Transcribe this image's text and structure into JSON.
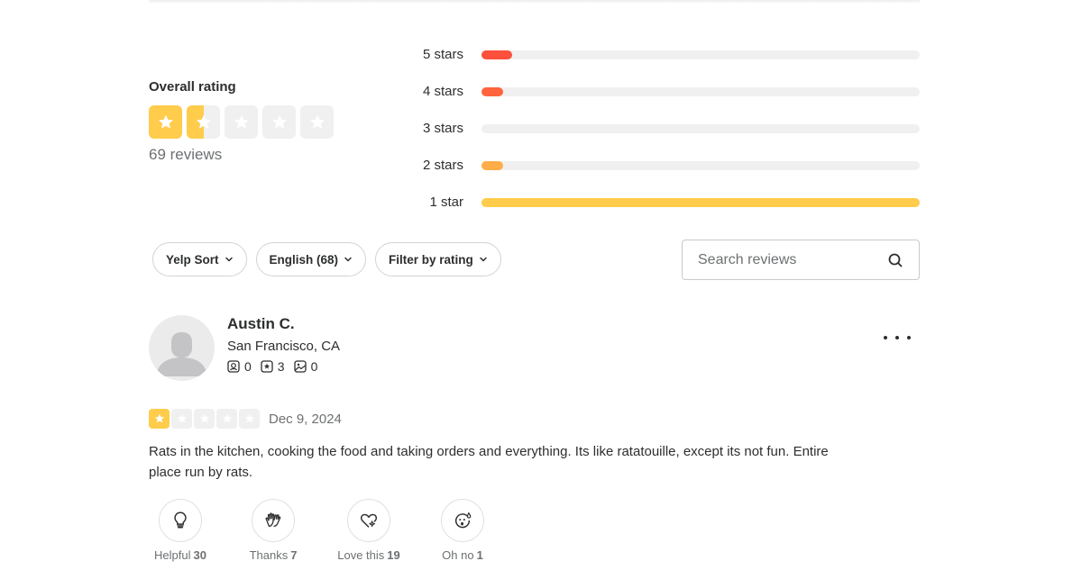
{
  "overall": {
    "title": "Overall rating",
    "rating": 1.5,
    "max_rating": 5,
    "review_count_label": "69 reviews"
  },
  "distribution": [
    {
      "label": "5 stars",
      "percent": 7,
      "color": "#fb503b"
    },
    {
      "label": "4 stars",
      "percent": 5,
      "color": "#ff643d"
    },
    {
      "label": "3 stars",
      "percent": 0,
      "color": "#ff8c3f"
    },
    {
      "label": "2 stars",
      "percent": 5,
      "color": "#ffad48"
    },
    {
      "label": "1 star",
      "percent": 100,
      "color": "#ffcc4b"
    }
  ],
  "filters": [
    {
      "label": "Yelp Sort",
      "icon": "chevron-down-icon"
    },
    {
      "label": "English (68)",
      "icon": "chevron-down-icon"
    },
    {
      "label": "Filter by rating",
      "icon": "chevron-down-icon"
    }
  ],
  "search": {
    "placeholder": "Search reviews",
    "value": "",
    "icon": "search-icon"
  },
  "review": {
    "user_name": "Austin C.",
    "location": "San Francisco, CA",
    "stats": [
      {
        "icon": "friends-icon",
        "value": "0"
      },
      {
        "icon": "reviews-icon",
        "value": "3"
      },
      {
        "icon": "photos-icon",
        "value": "0"
      }
    ],
    "rating": 1,
    "date": "Dec 9, 2024",
    "text": "Rats in the kitchen, cooking the food and taking orders and everything. Its like ratatouille, except its not fun. Entire place run by rats.",
    "more_icon": "more-options-icon",
    "reactions": [
      {
        "label": "Helpful",
        "count": "30",
        "icon": "lightbulb-icon"
      },
      {
        "label": "Thanks",
        "count": "7",
        "icon": "high-five-icon"
      },
      {
        "label": "Love this",
        "count": "19",
        "icon": "heart-sparkle-icon"
      },
      {
        "label": "Oh no",
        "count": "1",
        "icon": "oh-no-face-icon"
      }
    ]
  },
  "colors": {
    "star_fill": "#ffcc4b",
    "star_empty": "#f0f0f0",
    "text_primary": "#2d2e2f",
    "text_secondary": "#6e7072"
  }
}
